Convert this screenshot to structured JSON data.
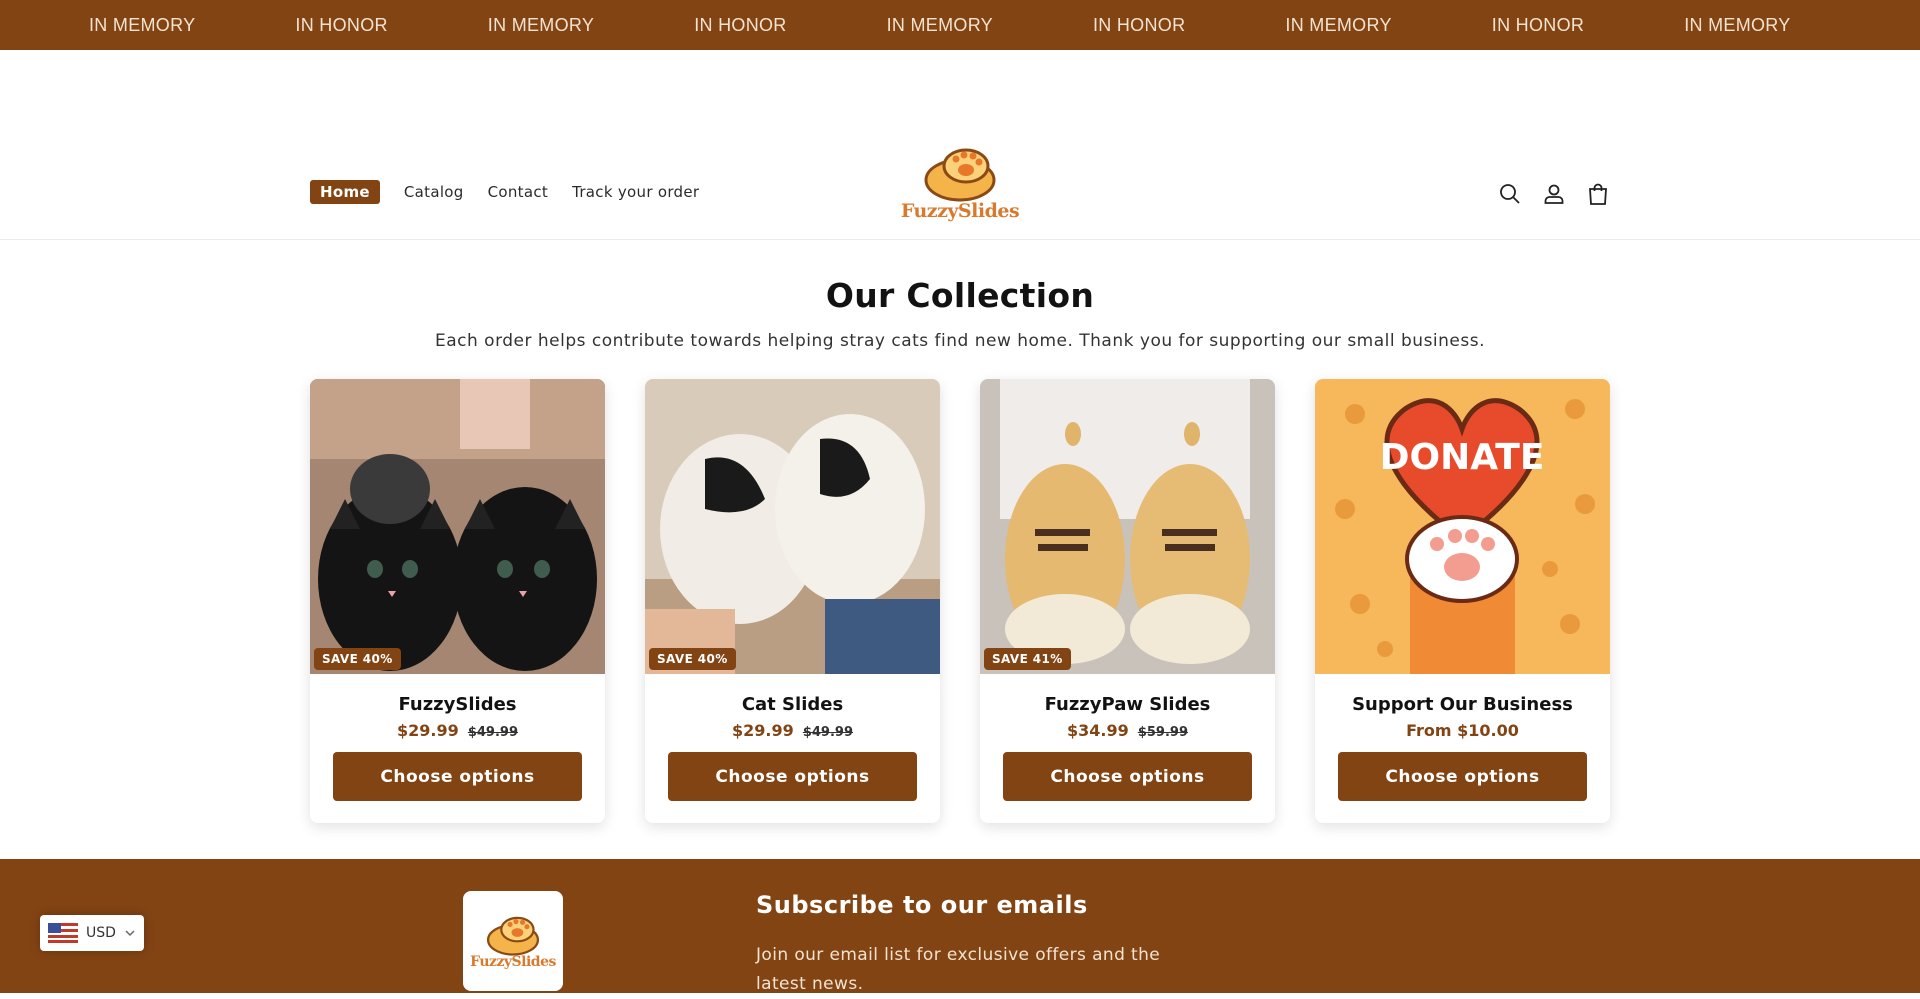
{
  "ticker": {
    "items": [
      "IN MEMORY",
      "IN HONOR",
      "IN MEMORY",
      "IN HONOR",
      "IN MEMORY",
      "IN HONOR",
      "IN MEMORY",
      "IN HONOR",
      "IN MEMORY"
    ]
  },
  "nav": {
    "items": [
      "Home",
      "Catalog",
      "Contact",
      "Track your order"
    ]
  },
  "logo": {
    "text": "FuzzySlides"
  },
  "header_icons": [
    "search-icon",
    "account-icon",
    "cart-icon"
  ],
  "collection": {
    "title": "Our Collection",
    "subtitle": "Each order helps contribute towards helping stray cats find new home. Thank you for supporting our small business."
  },
  "products": [
    {
      "title": "FuzzySlides",
      "price": "$29.99",
      "old_price": "$49.99",
      "badge": "SAVE 40%",
      "button": "Choose options"
    },
    {
      "title": "Cat Slides",
      "price": "$29.99",
      "old_price": "$49.99",
      "badge": "SAVE 40%",
      "button": "Choose options"
    },
    {
      "title": "FuzzyPaw Slides",
      "price": "$34.99",
      "old_price": "$59.99",
      "badge": "SAVE 41%",
      "button": "Choose options"
    },
    {
      "title": "Support Our Business",
      "price": "From $10.00",
      "old_price": "",
      "badge": "",
      "button": "Choose options",
      "image_text": "DONATE"
    }
  ],
  "footer": {
    "logo_text": "FuzzySlides",
    "subscribe_title": "Subscribe to our emails",
    "subscribe_text": "Join our email list for exclusive offers and the latest news."
  },
  "currency": {
    "code": "USD"
  },
  "colors": {
    "brand": "#834413",
    "accent": "#d9792c"
  }
}
